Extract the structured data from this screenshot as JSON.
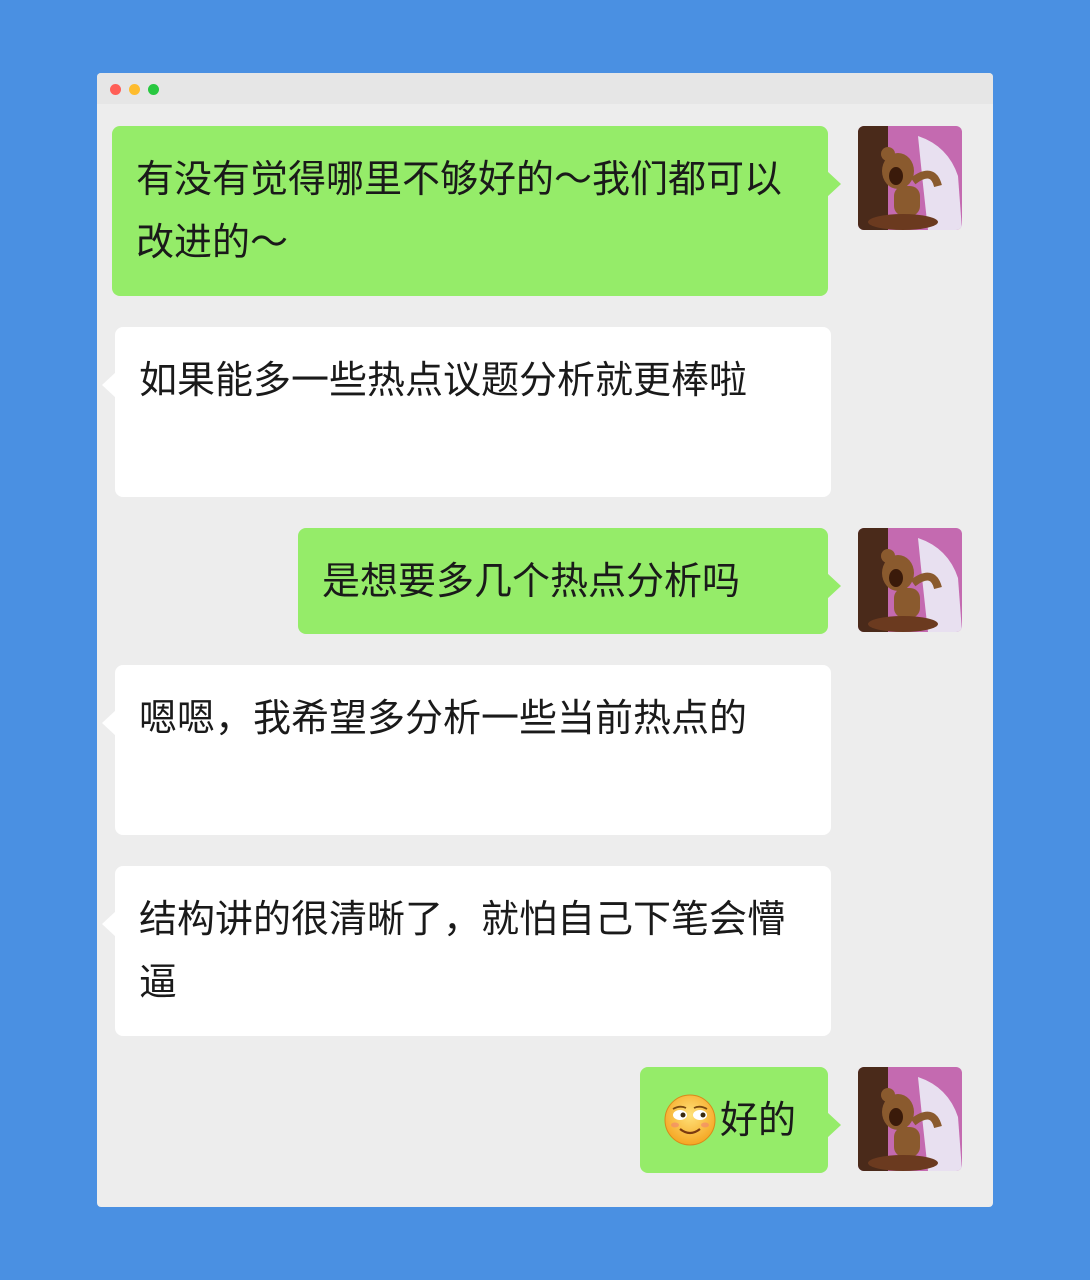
{
  "chat": {
    "messages": [
      {
        "side": "sent",
        "text": "有没有觉得哪里不够好的～我们都可以改进的～"
      },
      {
        "side": "recv",
        "text": "如果能多一些热点议题分析就更棒啦"
      },
      {
        "side": "sent",
        "text": "是想要多几个热点分析吗"
      },
      {
        "side": "recv",
        "text": "嗯嗯，我希望多分析一些当前热点的"
      },
      {
        "side": "recv",
        "text": "结构讲的很清晰了，就怕自己下笔会懵逼"
      },
      {
        "side": "sent",
        "emoji": "smirk-face-emoji",
        "text": "好的"
      }
    ]
  },
  "avatar": {
    "icon": "cartoon-mouse-avatar",
    "colors": {
      "bg": "#c46ab0",
      "body": "#8a5a2e",
      "frame": "#6b3a1f"
    }
  },
  "colors": {
    "background": "#4a90e2",
    "window": "#ededed",
    "sent_bubble": "#95ec69",
    "recv_bubble": "#ffffff"
  }
}
